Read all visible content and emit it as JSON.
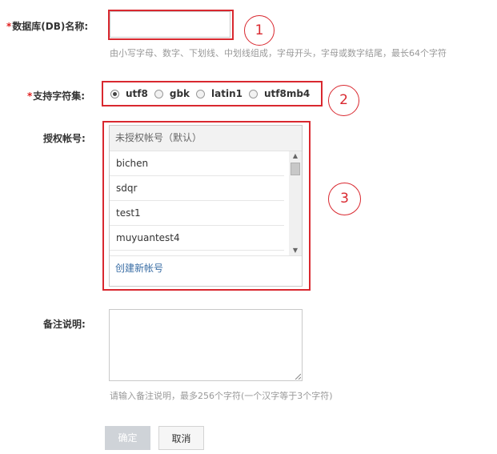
{
  "db_name": {
    "required_mark": "*",
    "label": "数据库(DB)名称:",
    "value": "",
    "hint": "由小写字母、数字、下划线、中划线组成，字母开头，字母或数字结尾，最长64个字符"
  },
  "charset": {
    "required_mark": "*",
    "label": "支持字符集:",
    "options": [
      "utf8",
      "gbk",
      "latin1",
      "utf8mb4"
    ],
    "selected": "utf8"
  },
  "accounts": {
    "label": "授权帐号:",
    "header": "未授权帐号（默认）",
    "items": [
      "bichen",
      "sdqr",
      "test1",
      "muyuantest4"
    ],
    "create_link": "创建新帐号",
    "scroll_up_icon": "triangle-up",
    "scroll_down_icon": "triangle-down"
  },
  "remark": {
    "label": "备注说明:",
    "value": "",
    "hint": "请输入备注说明，最多256个字符(一个汉字等于3个字符)"
  },
  "buttons": {
    "confirm": "确定",
    "cancel": "取消"
  },
  "annotations": {
    "circle_1": "1",
    "circle_2": "2",
    "circle_3": "3",
    "color": "#d9282f"
  },
  "colors": {
    "required": "#e02020",
    "link": "#3a6ea5",
    "hint": "#999999",
    "confirm_bg": "#cfd3d8"
  }
}
